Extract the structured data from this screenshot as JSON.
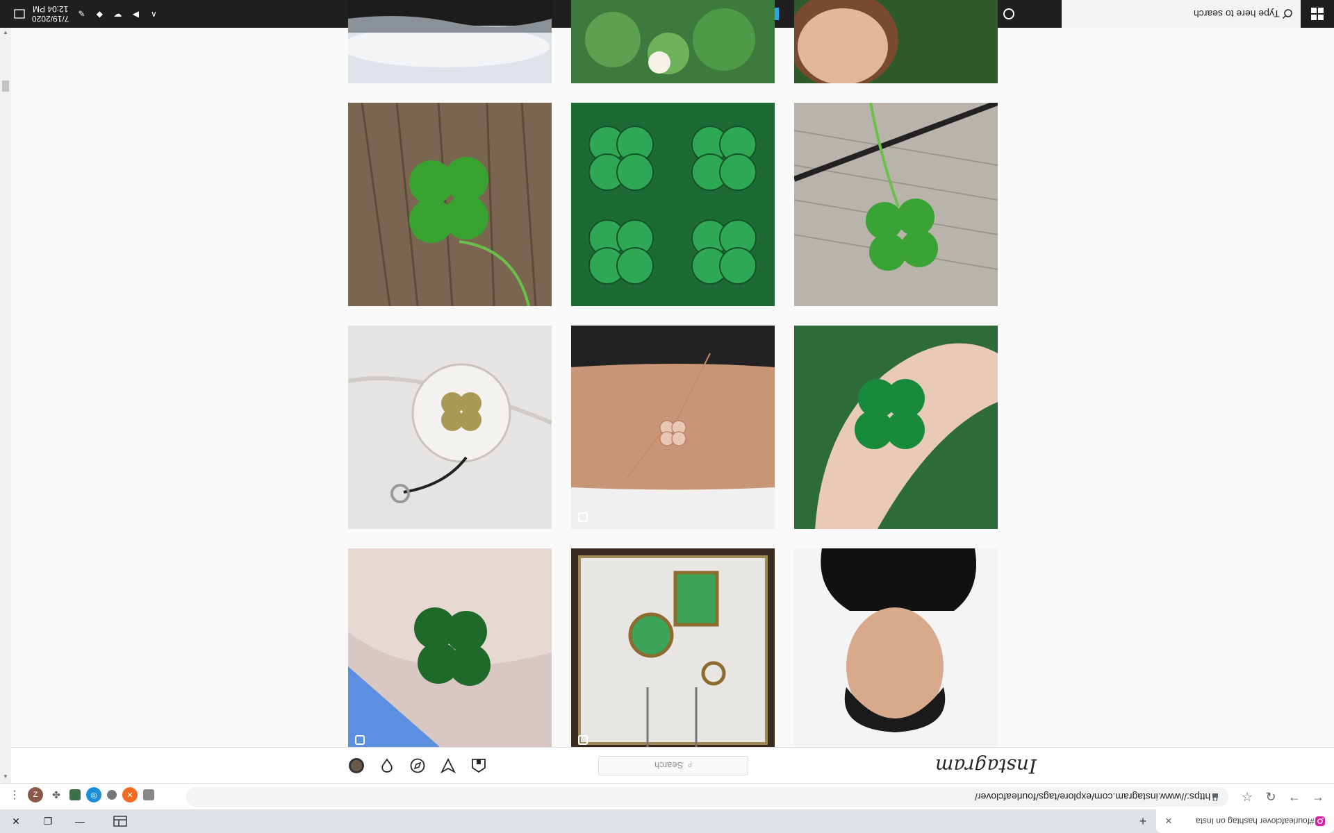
{
  "taskbar": {
    "search_placeholder": "Type here to search",
    "clock_time": "12:04 PM",
    "clock_date": "7/19/2020",
    "apps": [
      "cortana-icon",
      "task-view-icon",
      "microsoft-store-icon",
      "edge-icon",
      "file-explorer-icon",
      "photoshop-icon",
      "photos-icon",
      "chrome-icon",
      "outlook-icon"
    ]
  },
  "instagram": {
    "logo": "Instagram",
    "search_placeholder": "Search",
    "nav_icons": [
      "home-icon",
      "direct-icon",
      "explore-icon",
      "activity-icon",
      "profile-avatar"
    ]
  },
  "browser": {
    "url": "https://www.instagram.com/explore/tags/fourleafclover/",
    "tab_title": "#fourleafclover hashtag on Insta",
    "extensions": [
      "z-extension-icon",
      "puzzle-extension-icon",
      "green-extension-icon",
      "blue-extension-icon",
      "grey-extension-icon",
      "orange-extension-icon",
      "more-extension-icon"
    ]
  },
  "posts": [
    {
      "alt": "snowy landscape photo",
      "multi": false
    },
    {
      "alt": "white clover flower photo",
      "multi": false
    },
    {
      "alt": "face close-up photo",
      "multi": false
    },
    {
      "alt": "four-leaf clover on wood",
      "multi": false
    },
    {
      "alt": "four clover mosaic",
      "multi": false
    },
    {
      "alt": "four-leaf clover on boards",
      "multi": false
    },
    {
      "alt": "clover resin keychain",
      "multi": false
    },
    {
      "alt": "clover bracelet on wrist",
      "multi": true
    },
    {
      "alt": "clover held in fingers",
      "multi": false
    },
    {
      "alt": "clover held in hand",
      "multi": true
    },
    {
      "alt": "framed clover pendants",
      "multi": true
    },
    {
      "alt": "man portrait photo",
      "multi": false
    }
  ],
  "colors": {
    "taskbar": "#1f1f1f",
    "clover_green": "#2e8b3e",
    "tabstrip": "#dee1e6"
  }
}
